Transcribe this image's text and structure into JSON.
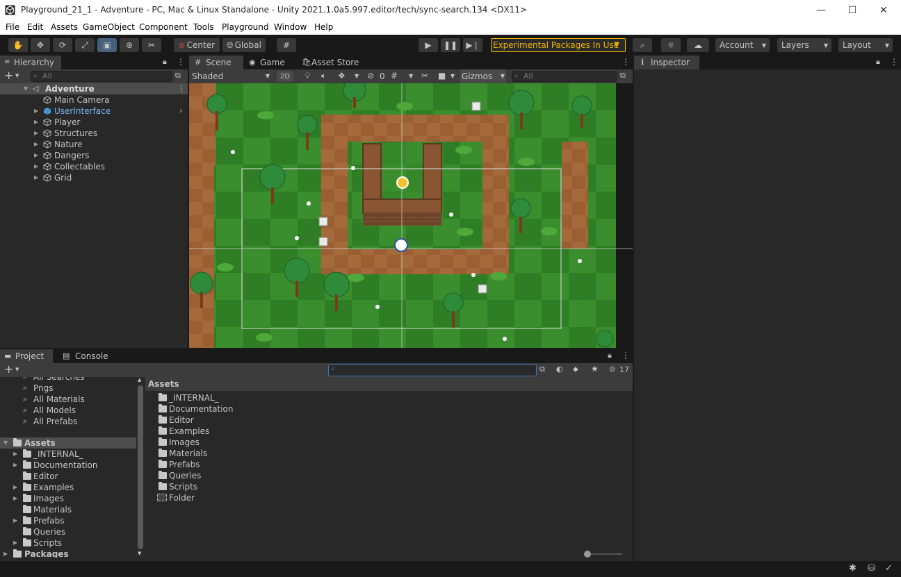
{
  "window": {
    "title": "Playground_21_1 - Adventure - PC, Mac & Linux Standalone - Unity 2021.1.0a5.997.editor/tech/sync-search.134 <DX11>",
    "minimize": "—",
    "maximize": "☐",
    "close": "✕"
  },
  "menu": [
    "File",
    "Edit",
    "Assets",
    "GameObject",
    "Component",
    "Tools",
    "Playground",
    "Window",
    "Help"
  ],
  "toolbar": {
    "pivot_label": "Center",
    "space_label": "Global",
    "experimental_label": "Experimental Packages In Use",
    "account_label": "Account",
    "layers_label": "Layers",
    "layout_label": "Layout"
  },
  "hierarchy": {
    "tab_label": "Hierarchy",
    "search_placeholder": "All",
    "scene_name": "Adventure",
    "items": [
      "Main Camera",
      "UserInterface",
      "Player",
      "Structures",
      "Nature",
      "Dangers",
      "Collectables",
      "Grid"
    ]
  },
  "scene": {
    "tabs": [
      "Scene",
      "Game",
      "Asset Store"
    ],
    "shading_mode": "Shaded",
    "mode_2d": "2D",
    "hidden_count": "0",
    "gizmos_label": "Gizmos",
    "search_placeholder": "All"
  },
  "inspector": {
    "tab_label": "Inspector"
  },
  "project": {
    "tabs": [
      "Project",
      "Console"
    ],
    "hidden_count": "17",
    "saved_searches": [
      "All Searches",
      "Pngs",
      "All Materials",
      "All Models",
      "All Prefabs"
    ],
    "tree_root": "Assets",
    "tree_items": [
      "_INTERNAL_",
      "Documentation",
      "Editor",
      "Examples",
      "Images",
      "Materials",
      "Prefabs",
      "Queries",
      "Scripts"
    ],
    "packages_label": "Packages",
    "breadcrumb": "Assets",
    "list_items": [
      "_INTERNAL_",
      "Documentation",
      "Editor",
      "Examples",
      "Images",
      "Materials",
      "Prefabs",
      "Queries",
      "Scripts",
      "Folder"
    ]
  },
  "colors": {
    "selection": "#2c5d87",
    "accent_warning": "#f0b400",
    "grass": "#3a8d2c",
    "dirt": "#a3673a"
  }
}
